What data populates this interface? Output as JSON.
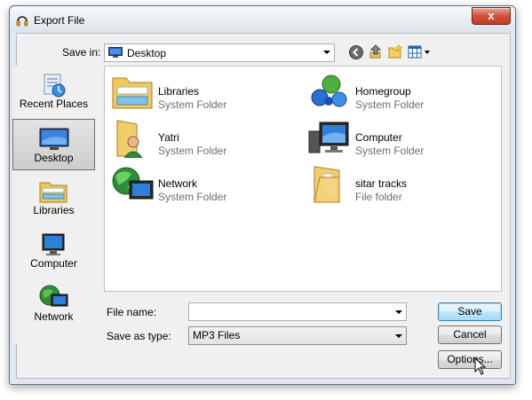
{
  "window": {
    "title": "Export File",
    "close_glyph": "x"
  },
  "toolbar": {
    "save_in_label": "Save in:",
    "location": "Desktop",
    "icons": [
      "back-icon",
      "up-folder-icon",
      "new-folder-icon",
      "view-menu-icon"
    ]
  },
  "places": [
    {
      "label": "Recent Places",
      "icon": "recent-places-icon",
      "selected": false
    },
    {
      "label": "Desktop",
      "icon": "desktop-icon",
      "selected": true
    },
    {
      "label": "Libraries",
      "icon": "libraries-icon",
      "selected": false
    },
    {
      "label": "Computer",
      "icon": "computer-icon",
      "selected": false
    },
    {
      "label": "Network",
      "icon": "network-icon",
      "selected": false
    }
  ],
  "files": [
    {
      "name": "Libraries",
      "type": "System Folder",
      "icon": "libraries-icon"
    },
    {
      "name": "Homegroup",
      "type": "System Folder",
      "icon": "homegroup-icon"
    },
    {
      "name": "Yatri",
      "type": "System Folder",
      "icon": "user-folder-icon"
    },
    {
      "name": "Computer",
      "type": "System Folder",
      "icon": "computer-icon"
    },
    {
      "name": "Network",
      "type": "System Folder",
      "icon": "network-icon"
    },
    {
      "name": "sitar tracks",
      "type": "File folder",
      "icon": "folder-icon"
    }
  ],
  "form": {
    "file_name_label": "File name:",
    "file_name_value": "",
    "save_as_type_label": "Save as type:",
    "save_as_type_value": "MP3 Files"
  },
  "buttons": {
    "save": "Save",
    "cancel": "Cancel",
    "options": "Options..."
  }
}
